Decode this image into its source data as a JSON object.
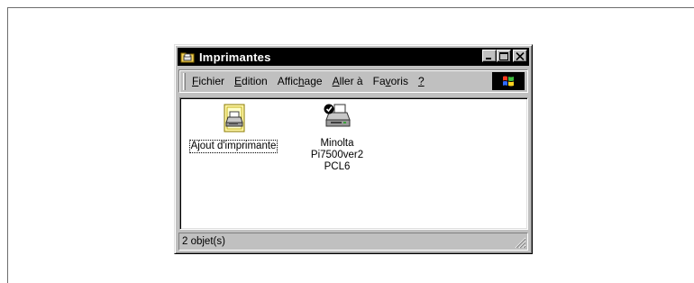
{
  "window": {
    "title": "Imprimantes",
    "buttons": {
      "minimize": "minimize",
      "maximize": "maximize",
      "close": "close"
    }
  },
  "menubar": {
    "items": [
      {
        "label": "Fichier",
        "accel": "F"
      },
      {
        "label": "Edition",
        "accel": "E"
      },
      {
        "label": "Affichage",
        "accel": "h"
      },
      {
        "label": "Aller à",
        "accel": "A"
      },
      {
        "label": "Favoris",
        "accel": "v"
      },
      {
        "label": "?",
        "accel": "?"
      }
    ]
  },
  "items": [
    {
      "icon": "add-printer-icon",
      "label_lines": [
        "Ajout d'imprimante"
      ],
      "focused": true
    },
    {
      "icon": "default-printer-icon",
      "label_lines": [
        "Minolta",
        "Pi7500ver2",
        "PCL6"
      ],
      "focused": false
    }
  ],
  "statusbar": {
    "text": "2 objet(s)"
  },
  "colors": {
    "titlebar": "#000000",
    "face": "#c0c0c0",
    "content": "#ffffff"
  }
}
